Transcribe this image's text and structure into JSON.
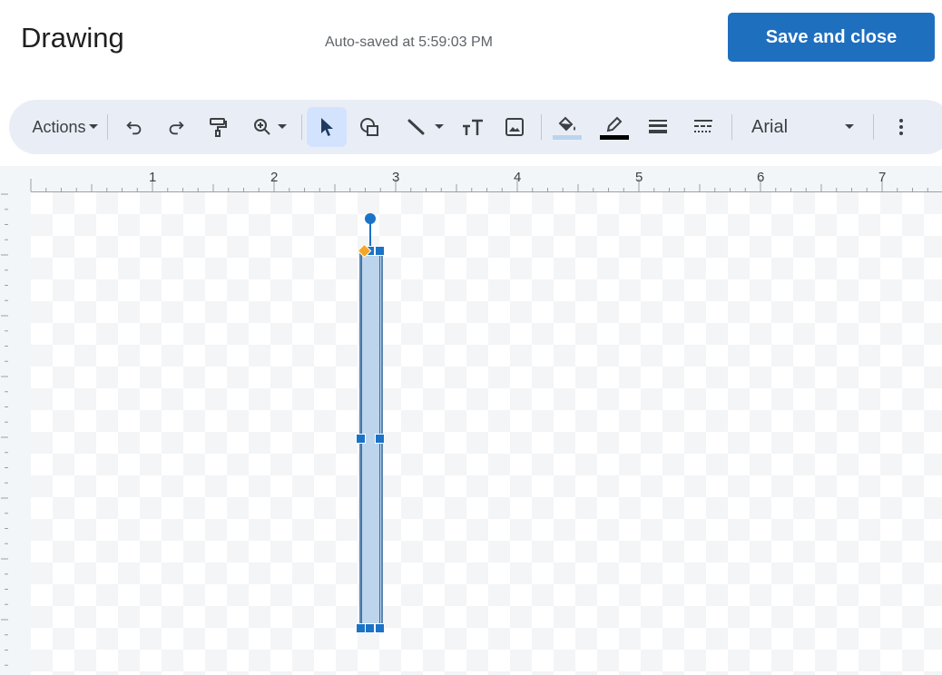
{
  "header": {
    "title": "Drawing",
    "autosave": "Auto-saved at 5:59:03 PM",
    "save_label": "Save and close"
  },
  "toolbar": {
    "actions_label": "Actions",
    "font_name": "Arial",
    "tools": [
      "undo-icon",
      "redo-icon",
      "paint-format-icon",
      "zoom-icon",
      "select-icon",
      "shape-icon",
      "line-icon",
      "text-box-icon",
      "image-icon",
      "fill-color-icon",
      "border-color-icon",
      "border-weight-icon",
      "border-dash-icon",
      "more-icon"
    ],
    "active_tool": "select-icon"
  },
  "ruler": {
    "labels": [
      "1",
      "2",
      "3",
      "4",
      "5",
      "6",
      "7"
    ]
  },
  "colors": {
    "primary": "#1f6fbf",
    "toolbar_bg": "#e9eef6",
    "shape_fill": "#bcd4ec",
    "handle": "#1a73c8",
    "adjust_handle": "#f5a623",
    "fill_color_swatch": "#bcd4ec",
    "border_color_swatch": "#000000"
  }
}
